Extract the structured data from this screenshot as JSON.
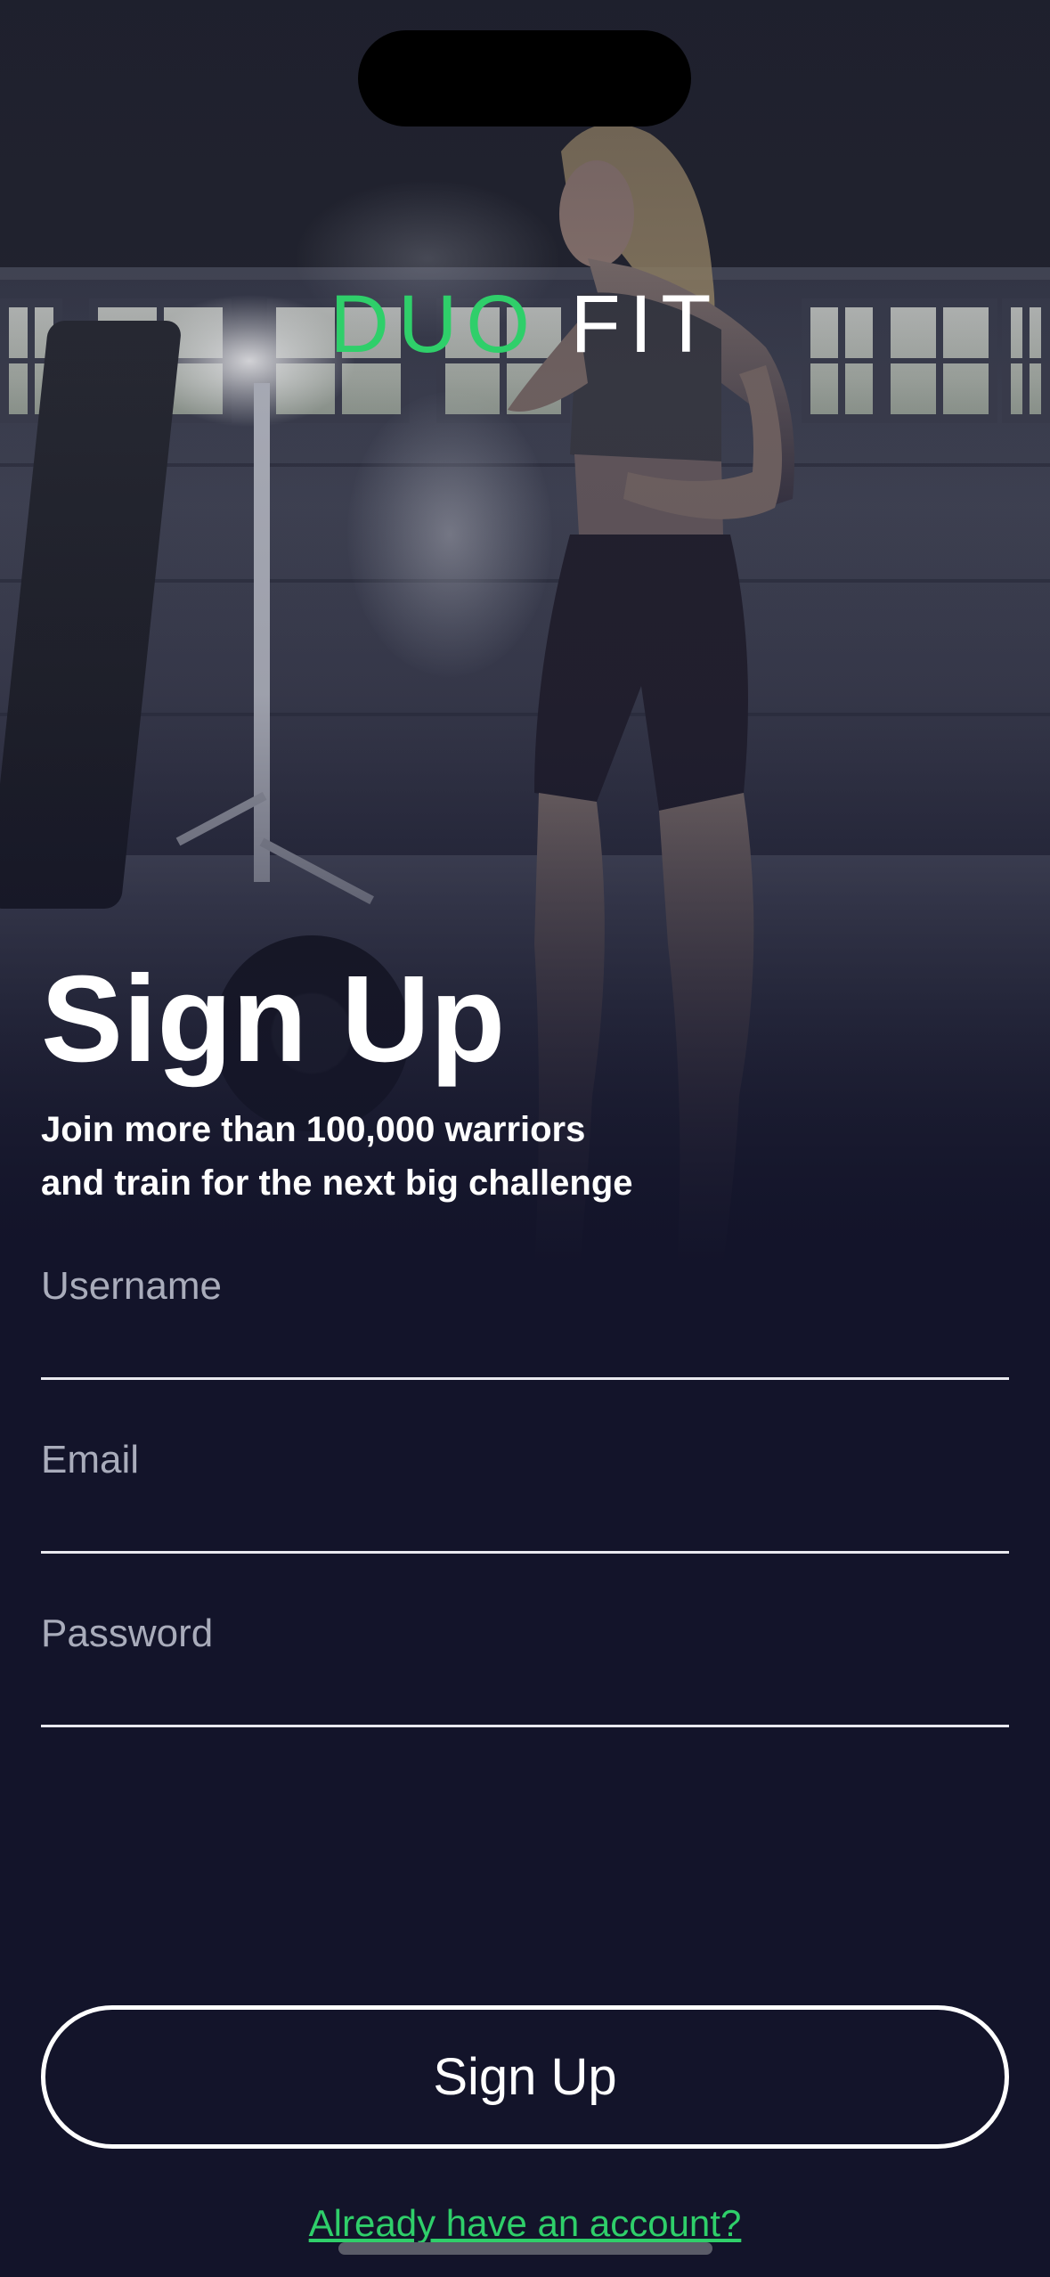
{
  "brand": {
    "logo_part1": "DUO",
    "logo_part2": " FIT",
    "accent_color": "#2fcf6a",
    "background_color": "#13142a"
  },
  "hero": {
    "image_description": "woman-chalking-hands-in-gym-photo"
  },
  "header": {
    "title": "Sign Up",
    "subtitle_line1": "Join more than 100,000 warriors",
    "subtitle_line2": "and train for the next big challenge"
  },
  "form": {
    "username_placeholder": "Username",
    "username_value": "",
    "email_placeholder": "Email",
    "email_value": "",
    "password_placeholder": "Password",
    "password_value": ""
  },
  "actions": {
    "signup_label": "Sign Up",
    "login_link_label": "Already have an account?"
  }
}
